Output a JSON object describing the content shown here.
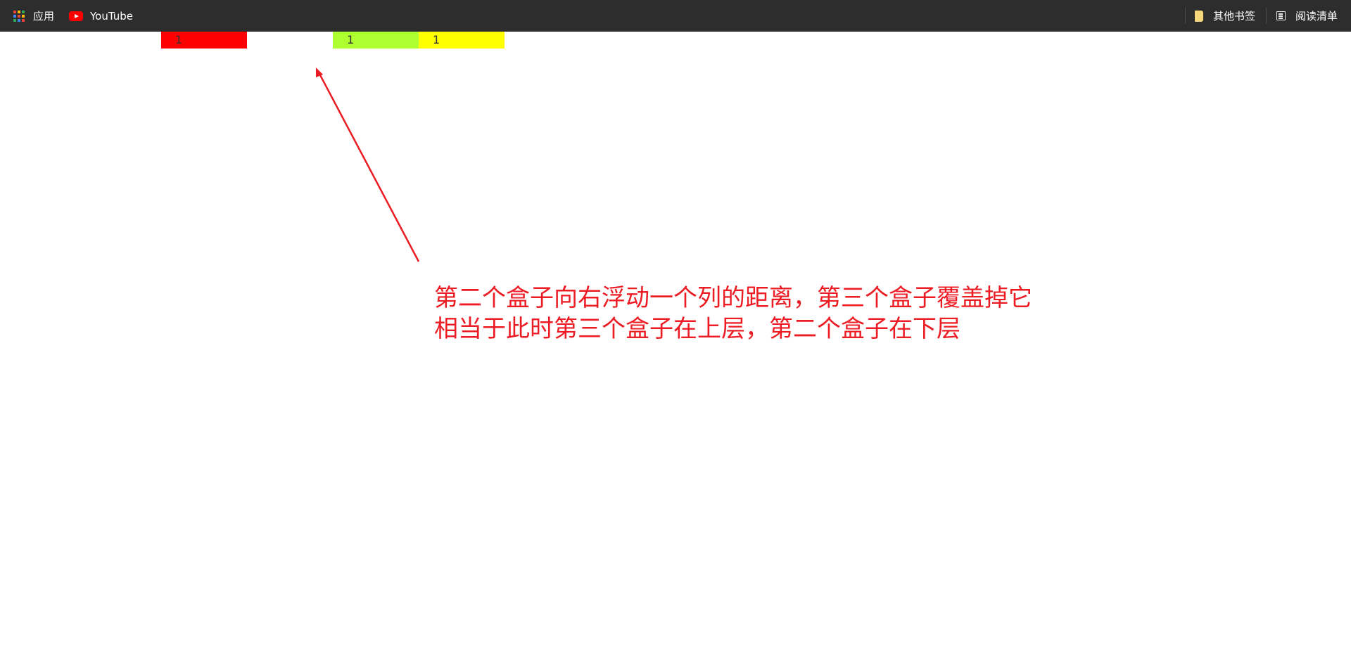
{
  "bookmarks_bar": {
    "apps_label": "应用",
    "youtube_label": "YouTube",
    "other_bookmarks_label": "其他书签",
    "reading_list_label": "阅读清单"
  },
  "page": {
    "boxes": [
      {
        "text": "1",
        "color": "#ff0000"
      },
      {
        "text": "1",
        "color": "#adff2f"
      },
      {
        "text": "1",
        "color": "#ffff00"
      }
    ]
  },
  "annotation": {
    "line1": "第二个盒子向右浮动一个列的距离，第三个盒子覆盖掉它",
    "line2": "相当于此时第三个盒子在上层，第二个盒子在下层",
    "color": "#ec1c24"
  }
}
